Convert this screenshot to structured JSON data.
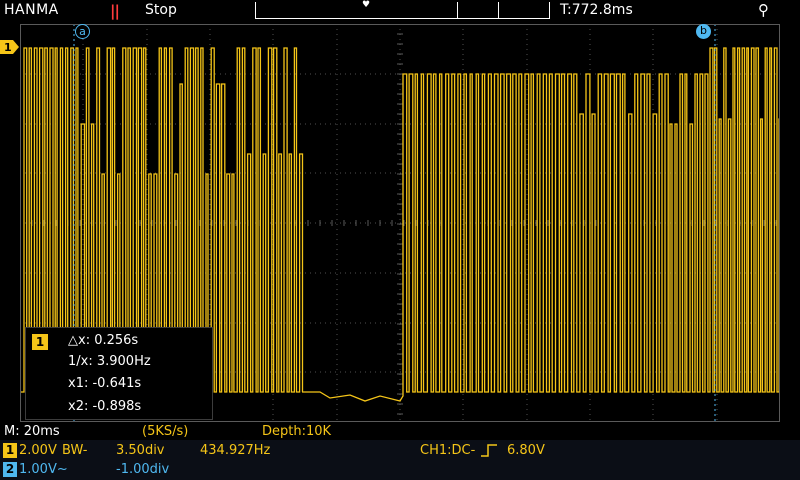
{
  "top": {
    "brand": "HANMA",
    "run_icon": "||",
    "run_state": "Stop",
    "memory_marker": "♥",
    "trigger_time": "T:772.8ms",
    "usb_icon": "usb-icon"
  },
  "cursors": {
    "a_label": "a",
    "b_label": "b"
  },
  "channel_marker": {
    "label": "1",
    "color": "#f5c518"
  },
  "measure": {
    "channel": "1",
    "dx": "△x: 0.256s",
    "inv_dx": "1/x: 3.900Hz",
    "x1": "x1: -0.641s",
    "x2": "x2: -0.898s"
  },
  "status": {
    "timebase": "M: 20ms",
    "sample_rate": "(5KS/s)",
    "depth": "Depth:10K"
  },
  "ch1": {
    "badge": "1",
    "scale": "2.00V",
    "bw": "BW-",
    "offset": "3.50div",
    "freq": "434.927Hz",
    "trigger": "CH1:DC-",
    "trigger_level": "6.80V",
    "color": "#f5c518"
  },
  "ch2": {
    "badge": "2",
    "scale": "1.00V~",
    "offset": "-1.00div",
    "color": "#4fb8f0"
  }
}
